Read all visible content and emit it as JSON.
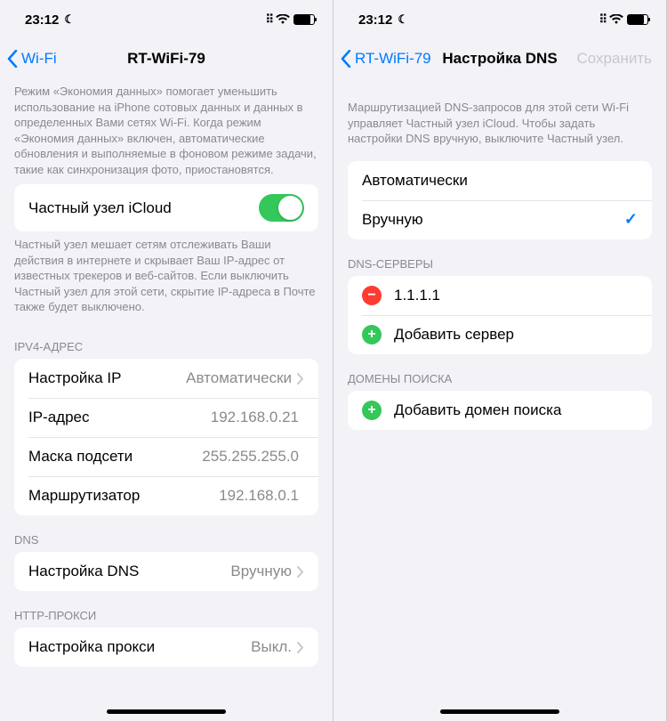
{
  "status": {
    "time": "23:12"
  },
  "screen1": {
    "nav": {
      "back": "Wi-Fi",
      "title": "RT-WiFi-79"
    },
    "data_saver_footer": "Режим «Экономия данных» помогает уменьшить использование на iPhone сотовых данных и данных в определенных Вами сетях Wi-Fi. Когда режим «Экономия данных» включен, автоматические обновления и выполняемые в фоновом режиме задачи, такие как синхронизация фото, приостановятся.",
    "private_relay_label": "Частный узел iCloud",
    "private_relay_footer": "Частный узел мешает сетям отслеживать Ваши действия в интернете и скрывает Ваш IP-адрес от известных трекеров и веб-сайтов. Если выключить Частный узел для этой сети, скрытие IP-адреса в Почте также будет выключено.",
    "ipv4_header": "IPV4-АДРЕС",
    "ipv4": {
      "configure_label": "Настройка IP",
      "configure_value": "Автоматически",
      "ip_label": "IP-адрес",
      "ip_value": "192.168.0.21",
      "mask_label": "Маска подсети",
      "mask_value": "255.255.255.0",
      "router_label": "Маршрутизатор",
      "router_value": "192.168.0.1"
    },
    "dns_header": "DNS",
    "dns": {
      "configure_label": "Настройка DNS",
      "configure_value": "Вручную"
    },
    "proxy_header": "HTTP-ПРОКСИ",
    "proxy": {
      "configure_label": "Настройка прокси",
      "configure_value": "Выкл."
    }
  },
  "screen2": {
    "nav": {
      "back": "RT-WiFi-79",
      "title": "Настройка DNS",
      "action": "Сохранить"
    },
    "info_footer": "Маршрутизацией DNS-запросов для этой сети Wi-Fi управляет Частный узел iCloud. Чтобы задать настройки DNS вручную, выключите Частный узел.",
    "mode": {
      "automatic": "Автоматически",
      "manual": "Вручную"
    },
    "servers_header": "DNS-СЕРВЕРЫ",
    "servers": {
      "server1": "1.1.1.1",
      "add_server": "Добавить сервер"
    },
    "search_header": "ДОМЕНЫ ПОИСКА",
    "search": {
      "add_domain": "Добавить домен поиска"
    }
  }
}
